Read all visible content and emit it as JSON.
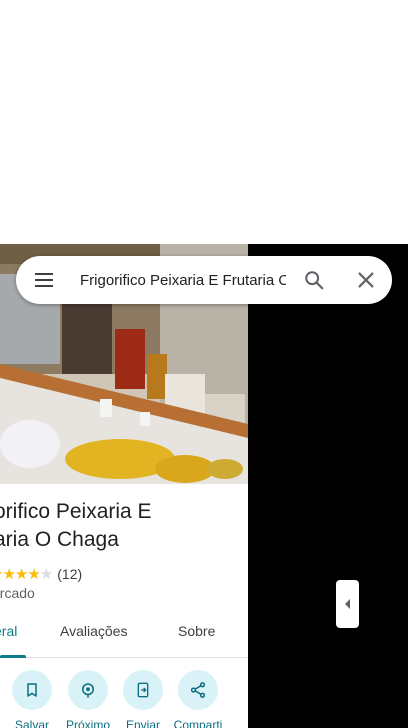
{
  "search": {
    "value": "Frigorifico Peixaria E Frutaria O Chaga"
  },
  "place": {
    "title": "orifico Peixaria E\naria O Chaga",
    "rating_count": "(12)",
    "rating_value": 3.5,
    "category": "ercado"
  },
  "tabs": [
    {
      "label": "eral",
      "active": true
    },
    {
      "label": "Avaliações",
      "active": false
    },
    {
      "label": "Sobre",
      "active": false
    }
  ],
  "actions": [
    {
      "label": "Salvar",
      "icon": "bookmark-icon"
    },
    {
      "label": "Próximo",
      "icon": "nearby-icon"
    },
    {
      "label": "Enviar",
      "icon": "send-to-phone-icon"
    },
    {
      "label": "Comparti",
      "icon": "share-icon"
    }
  ],
  "colors": {
    "accent": "#0b7a8a",
    "action_bg": "#d9f2f7",
    "star": "#fbbc04",
    "side_panel": "#000000"
  }
}
